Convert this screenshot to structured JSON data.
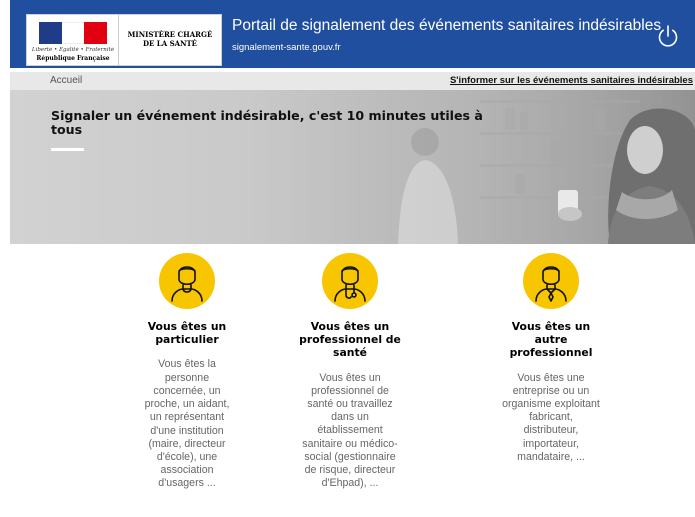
{
  "header": {
    "republique_devise": "Liberté • Égalité • Fraternité",
    "republique_label": "République Française",
    "ministere_line1": "MINISTÈRE CHARGÉ",
    "ministere_line2": "DE LA SANTÉ",
    "title": "Portail de signalement des événements sanitaires indésirables",
    "url": "signalement-sante.gouv.fr",
    "power_icon": "power-icon"
  },
  "nav": {
    "breadcrumb": "Accueil",
    "inform_link": "S'informer sur les événements sanitaires indésirables"
  },
  "hero": {
    "title": "Signaler un événement indésirable, c'est 10 minutes utiles à tous"
  },
  "cards": [
    {
      "icon": "person-icon",
      "title_lines": [
        "Vous êtes un",
        "particulier"
      ],
      "description_lines": [
        "Vous êtes la",
        "personne",
        "concernée, un",
        "proche, un aidant,",
        "un représentant",
        "d'une institution",
        "(maire, directeur",
        "d'école), une",
        "association",
        "d'usagers ..."
      ]
    },
    {
      "icon": "health-professional-icon",
      "title_lines": [
        "Vous êtes un",
        "professionnel de",
        "santé"
      ],
      "description_lines": [
        "Vous êtes un",
        "professionnel de",
        "santé ou travaillez",
        "dans un",
        "établissement",
        "sanitaire ou médico-",
        "social (gestionnaire",
        "de risque, directeur",
        "d'Ehpad), ..."
      ]
    },
    {
      "icon": "other-professional-icon",
      "title_lines": [
        "Vous êtes un",
        "autre",
        "professionnel"
      ],
      "description_lines": [
        "Vous êtes une",
        "entreprise ou un",
        "organisme exploitant",
        "fabricant,",
        "distributeur,",
        "importateur,",
        "mandataire, ..."
      ]
    }
  ],
  "colors": {
    "header_bg": "#1f4f9e",
    "accent_yellow": "#f7c600"
  }
}
